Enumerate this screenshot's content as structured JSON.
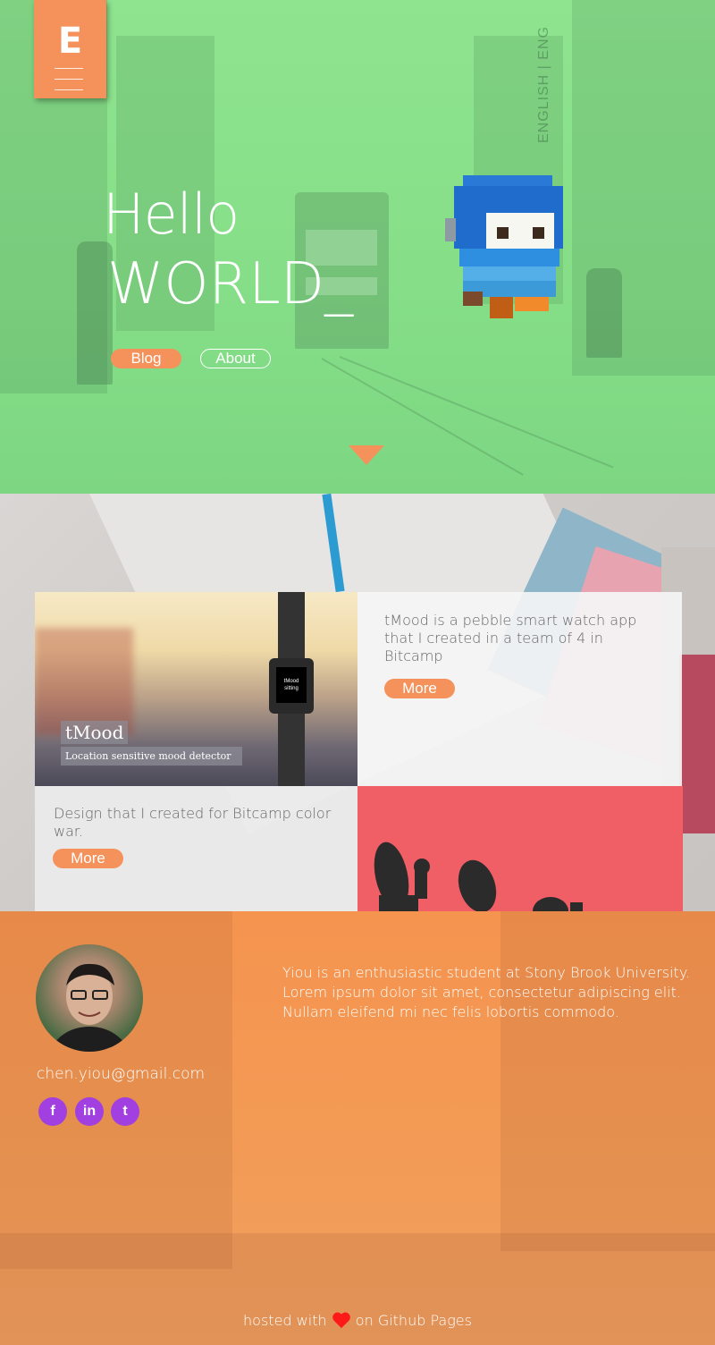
{
  "logo": {
    "letter": "E"
  },
  "hero": {
    "lang_toggle": "ENGLISH | ENG",
    "headline_line1": "Hello",
    "headline_line2": "WORLD_",
    "blog_button": "Blog",
    "about_button": "About"
  },
  "projects": {
    "tmood": {
      "title": "tMood",
      "subtitle": "Location sensitive mood detector",
      "watch_title": "tMood",
      "watch_sub": "sitting",
      "description": "tMood is a pebble smart watch app that I created in a team of 4 in Bitcamp",
      "more_label": "More"
    },
    "bitcamp": {
      "description": "Design that I created for Bitcamp color war.",
      "more_label": "More"
    }
  },
  "about": {
    "email": "chen.yiou@gmail.com",
    "bio": "Yiou is an enthusiastic student at Stony Brook University. Lorem ipsum dolor sit amet, consectetur adipiscing elit. Nullam eleifend mi nec felis lobortis commodo.",
    "social": [
      {
        "icon": "facebook-icon",
        "glyph": "f"
      },
      {
        "icon": "linkedin-icon",
        "glyph": "in"
      },
      {
        "icon": "twitter-icon",
        "glyph": "t"
      }
    ]
  },
  "footer": {
    "prefix": "hosted with",
    "suffix": "on Github Pages"
  },
  "colors": {
    "accent": "#f5915b",
    "hero_overlay": "#8fe48f",
    "about_overlay": "#f5944f",
    "social": "#a13fe0",
    "bitcamp_card": "#ef5f65",
    "heart": "#ff1a1a"
  }
}
